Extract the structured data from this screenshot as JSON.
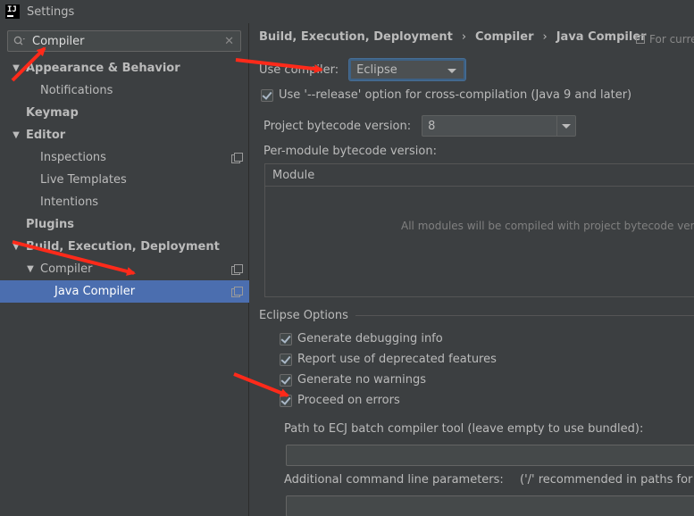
{
  "window": {
    "title": "Settings",
    "logo_text": "IJ"
  },
  "search": {
    "value": "Compiler"
  },
  "tree": {
    "items": [
      {
        "label": "Appearance & Behavior",
        "bold": true,
        "expanded": true
      },
      {
        "label": "Notifications"
      },
      {
        "label": "Keymap",
        "bold": true
      },
      {
        "label": "Editor",
        "bold": true,
        "expanded": true
      },
      {
        "label": "Inspections",
        "project_icon": true
      },
      {
        "label": "Live Templates"
      },
      {
        "label": "Intentions"
      },
      {
        "label": "Plugins",
        "bold": true
      },
      {
        "label": "Build, Execution, Deployment",
        "bold": true,
        "expanded": true
      },
      {
        "label": "Compiler",
        "expanded": true,
        "project_icon": true
      },
      {
        "label": "Java Compiler",
        "selected": true,
        "project_icon": true
      }
    ]
  },
  "breadcrumb": [
    "Build, Execution, Deployment",
    "Compiler",
    "Java Compiler"
  ],
  "breadcrumb_sep": "›",
  "for_current": "For curre",
  "compiler": {
    "use_compiler_label": "Use compiler:",
    "use_compiler_value": "Eclipse",
    "release_option_label": "Use '--release' option for cross-compilation (Java 9 and later)",
    "release_option_checked": true,
    "bytecode_label": "Project bytecode version:",
    "bytecode_value": "8",
    "per_module_label": "Per-module bytecode version:",
    "module_column": "Module",
    "module_empty_text": "All modules will be compiled with project bytecode versi"
  },
  "eclipse": {
    "group_title": "Eclipse Options",
    "options": [
      {
        "label": "Generate debugging info",
        "checked": true
      },
      {
        "label": "Report use of deprecated features",
        "checked": true
      },
      {
        "label": "Generate no warnings",
        "checked": true
      },
      {
        "label": "Proceed on errors",
        "checked": true
      }
    ],
    "ecj_path_label": "Path to ECJ batch compiler tool (leave empty to use bundled):",
    "ecj_path_value": "",
    "cmdline_label": "Additional command line parameters:",
    "cmdline_hint": "('/' recommended in paths for cro",
    "cmdline_value": ""
  },
  "colors": {
    "background": "#3c3f41",
    "selection": "#4b6eaf",
    "annotation_arrow": "#ff2a1a"
  }
}
